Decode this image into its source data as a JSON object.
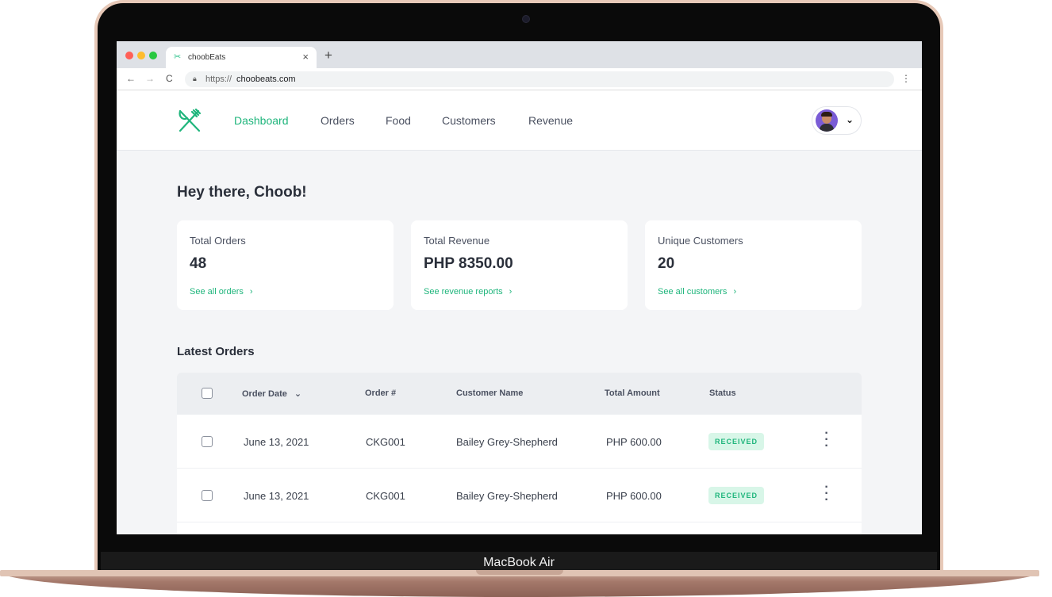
{
  "device": {
    "label": "MacBook Air"
  },
  "browser": {
    "tab_title": "choobEats",
    "tab_close": "×",
    "new_tab": "+",
    "url_prefix": "https://",
    "url_host": "choobeats.com",
    "back": "←",
    "forward": "→",
    "reload": "C"
  },
  "nav": {
    "items": [
      {
        "label": "Dashboard",
        "active": true
      },
      {
        "label": "Orders"
      },
      {
        "label": "Food"
      },
      {
        "label": "Customers"
      },
      {
        "label": "Revenue"
      }
    ]
  },
  "greeting": "Hey there, Choob!",
  "stats": [
    {
      "label": "Total Orders",
      "value": "48",
      "link": "See all orders"
    },
    {
      "label": "Total Revenue",
      "value": "PHP 8350.00",
      "link": "See revenue reports"
    },
    {
      "label": "Unique Customers",
      "value": "20",
      "link": "See all customers"
    }
  ],
  "orders": {
    "title": "Latest Orders",
    "columns": [
      "Order Date",
      "Order #",
      "Customer Name",
      "Total Amount",
      "Status"
    ],
    "rows": [
      {
        "date": "June 13, 2021",
        "id": "CKG001",
        "customer": "Bailey Grey-Shepherd",
        "amount": "PHP 600.00",
        "status": "RECEIVED"
      },
      {
        "date": "June 13, 2021",
        "id": "CKG001",
        "customer": "Bailey Grey-Shepherd",
        "amount": "PHP 600.00",
        "status": "RECEIVED"
      }
    ]
  },
  "colors": {
    "accent": "#1fb57c",
    "badge_bg": "#d8f6e8",
    "page_bg": "#f4f5f7"
  }
}
